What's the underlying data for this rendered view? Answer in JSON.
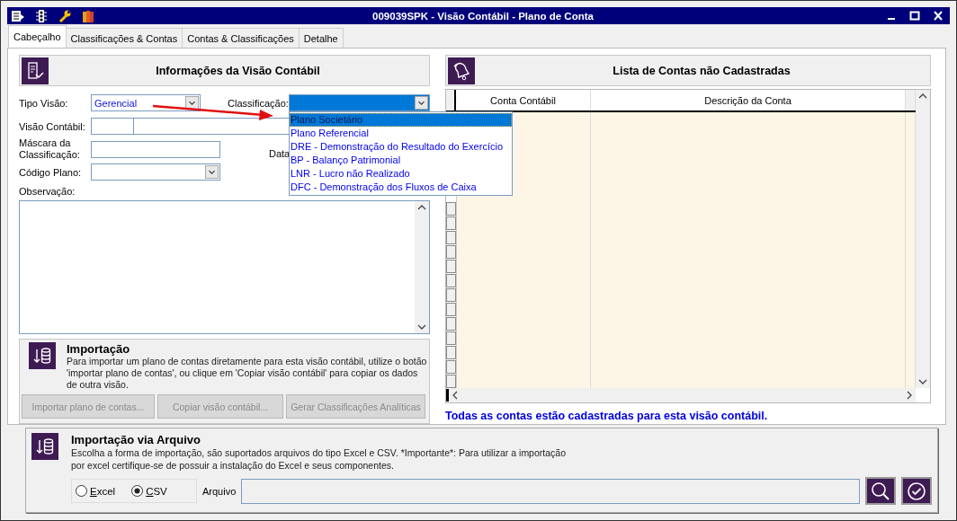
{
  "window": {
    "title": "009039SPK - Visão Contábil - Plano de Conta"
  },
  "tabs": [
    {
      "label": "Cabeçalho",
      "selected": true
    },
    {
      "label": "Classificações & Contas",
      "selected": false
    },
    {
      "label": "Contas & Classificações",
      "selected": false
    },
    {
      "label": "Detalhe",
      "selected": false
    }
  ],
  "info_panel": {
    "title": "Informações da Visão Contábil",
    "tipo_visao": {
      "label": "Tipo Visão:",
      "value": "Gerencial"
    },
    "classificacao": {
      "label": "Classificação:",
      "expanded": true,
      "options": [
        {
          "label": "Plano Societário",
          "selected": true
        },
        {
          "label": "Plano Referencial",
          "selected": false
        },
        {
          "label": "DRE - Demonstração do Resultado do Exercício",
          "selected": false
        },
        {
          "label": "BP - Balanço Patrimonial",
          "selected": false
        },
        {
          "label": "LNR - Lucro não Realizado",
          "selected": false
        },
        {
          "label": "DFC - Demonstração dos Fluxos de Caixa",
          "selected": false
        }
      ]
    },
    "visao_contabil": {
      "label": "Visão Contábil:"
    },
    "mascara": {
      "label": "Máscara da Classificação:"
    },
    "data": {
      "label": "Data"
    },
    "codigo_plano": {
      "label": "Código Plano:"
    },
    "observacao": {
      "label": "Observação:"
    }
  },
  "importacao": {
    "title": "Importação",
    "text": "Para importar um plano de contas diretamente para esta visão contábil, utilize o botão 'importar plano de contas', ou clique em 'Copiar visão contábil' para copiar os dados de outra visão.",
    "buttons": [
      {
        "label": "Importar plano de contas...",
        "disabled": true
      },
      {
        "label": "Copiar visão contábil...",
        "disabled": true
      },
      {
        "label": "Gerar Classificações Analíticas",
        "disabled": true
      }
    ]
  },
  "contas_panel": {
    "title": "Lista de Contas não Cadastradas",
    "columns": [
      "Conta Contábil",
      "Descrição da Conta"
    ],
    "message": "Todas as contas estão cadastradas para esta visão contábil."
  },
  "import_file": {
    "title": "Importação via Arquivo",
    "text": "Escolha a forma de importação, são suportados arquivos do tipo Excel e CSV. *Importante*: Para utilizar a importação por excel certifique-se de possuir a instalação do Excel e seus componentes.",
    "options": [
      {
        "label": "Excel",
        "selected": false
      },
      {
        "label": "CSV",
        "selected": true
      }
    ],
    "file_label": "Arquivo"
  }
}
